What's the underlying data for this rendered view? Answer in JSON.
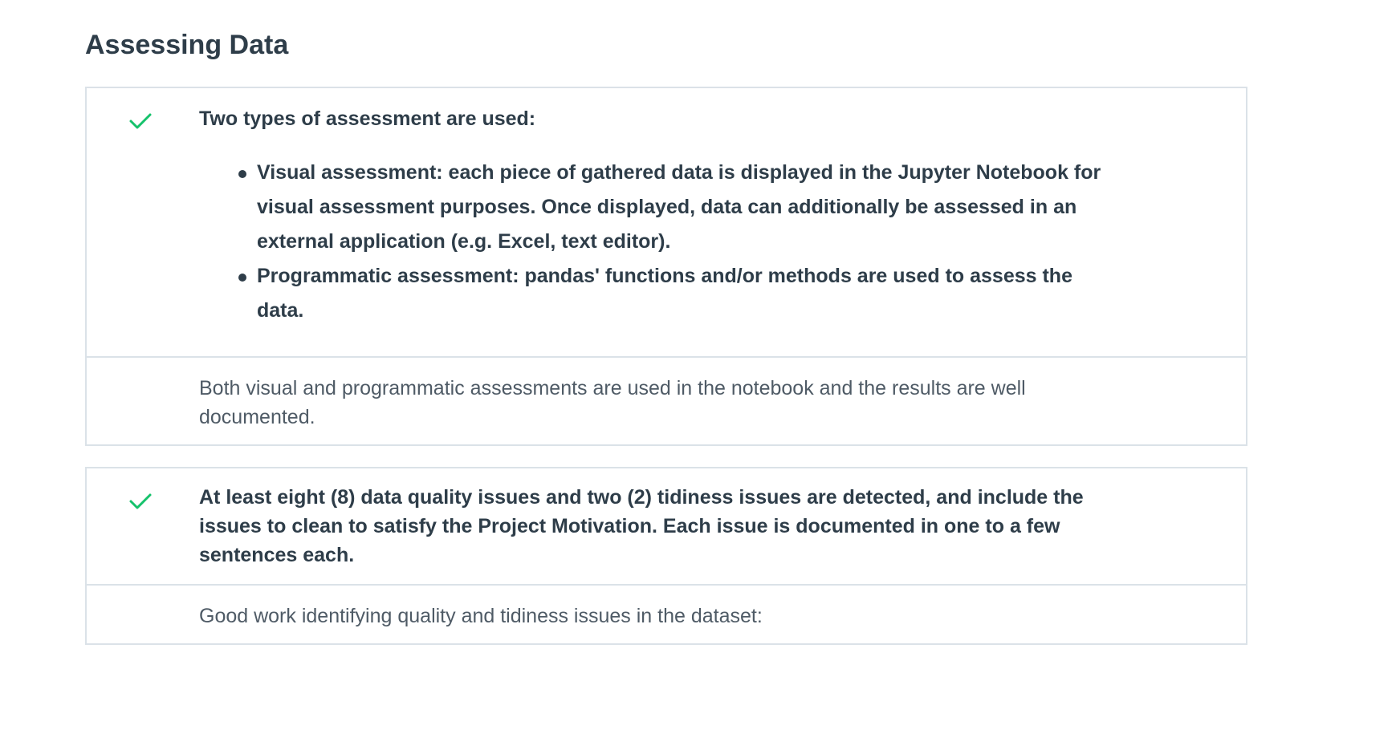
{
  "section": {
    "title": "Assessing Data"
  },
  "colors": {
    "check": "#02b3e4",
    "check_green": "#15c26b",
    "text": "#2e3d49",
    "border": "#dbe2e8"
  },
  "rubric_items": [
    {
      "status_icon": "check-icon",
      "heading": "Two types of assessment are used:",
      "bullets": [
        "Visual assessment: each piece of gathered data is displayed in the Jupyter Notebook for visual assessment purposes. Once displayed, data can additionally be assessed in an external application (e.g. Excel, text editor).",
        "Programmatic assessment: pandas' functions and/or methods are used to assess the data."
      ],
      "comment": "Both visual and programmatic assessments are used in the notebook and the results are well documented."
    },
    {
      "status_icon": "check-icon",
      "heading": "At least eight (8) data quality issues and two (2) tidiness issues are detected, and include the issues to clean to satisfy the Project Motivation. Each issue is documented in one to a few sentences each.",
      "comment": "Good work identifying quality and tidiness issues in the dataset:"
    }
  ]
}
